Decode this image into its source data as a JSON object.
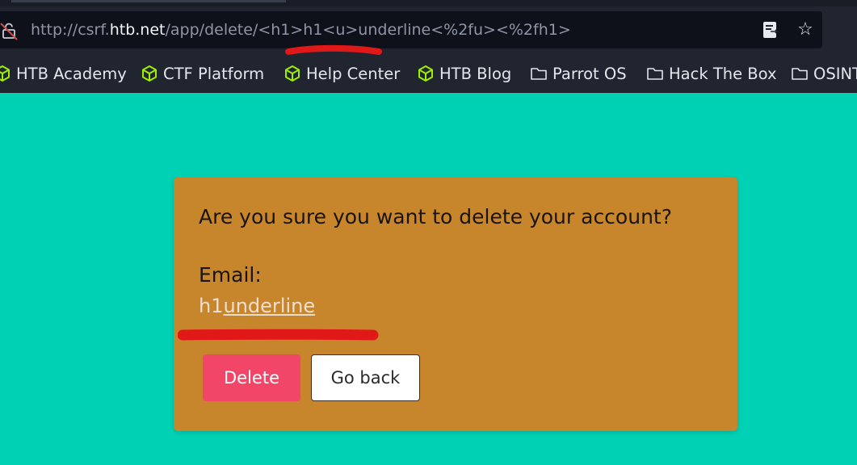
{
  "browser": {
    "url_prefix": "http://csrf.",
    "url_host": "htb.net",
    "url_path": "/app/delete/<h1>h1<u>underline<%2fu><%2fh1>",
    "bookmarks": [
      {
        "label": "HTB Academy",
        "icon": "hackthebox-cube-icon"
      },
      {
        "label": "CTF Platform",
        "icon": "hackthebox-cube-icon"
      },
      {
        "label": "Help Center",
        "icon": "hackthebox-cube-icon"
      },
      {
        "label": "HTB Blog",
        "icon": "hackthebox-cube-icon"
      },
      {
        "label": "Parrot OS",
        "icon": "folder-icon"
      },
      {
        "label": "Hack The Box",
        "icon": "folder-icon"
      },
      {
        "label": "OSINT",
        "icon": "folder-icon"
      }
    ]
  },
  "dialog": {
    "question": "Are you sure you want to delete your account?",
    "email_label": "Email:",
    "email_plain": "h1",
    "email_underlined": "underline",
    "delete_label": "Delete",
    "back_label": "Go back"
  },
  "colors": {
    "page_background": "#00d1b4",
    "card_background": "#c8862c",
    "delete_button": "#f14668",
    "annotation_red": "#e01818",
    "htb_green": "#9fef00"
  }
}
